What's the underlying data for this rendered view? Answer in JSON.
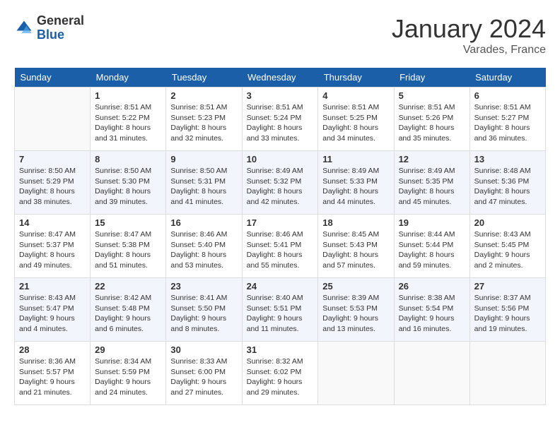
{
  "header": {
    "logo_general": "General",
    "logo_blue": "Blue",
    "month": "January 2024",
    "location": "Varades, France"
  },
  "weekdays": [
    "Sunday",
    "Monday",
    "Tuesday",
    "Wednesday",
    "Thursday",
    "Friday",
    "Saturday"
  ],
  "weeks": [
    [
      {
        "day": "",
        "content": ""
      },
      {
        "day": "1",
        "content": "Sunrise: 8:51 AM\nSunset: 5:22 PM\nDaylight: 8 hours\nand 31 minutes."
      },
      {
        "day": "2",
        "content": "Sunrise: 8:51 AM\nSunset: 5:23 PM\nDaylight: 8 hours\nand 32 minutes."
      },
      {
        "day": "3",
        "content": "Sunrise: 8:51 AM\nSunset: 5:24 PM\nDaylight: 8 hours\nand 33 minutes."
      },
      {
        "day": "4",
        "content": "Sunrise: 8:51 AM\nSunset: 5:25 PM\nDaylight: 8 hours\nand 34 minutes."
      },
      {
        "day": "5",
        "content": "Sunrise: 8:51 AM\nSunset: 5:26 PM\nDaylight: 8 hours\nand 35 minutes."
      },
      {
        "day": "6",
        "content": "Sunrise: 8:51 AM\nSunset: 5:27 PM\nDaylight: 8 hours\nand 36 minutes."
      }
    ],
    [
      {
        "day": "7",
        "content": "Sunrise: 8:50 AM\nSunset: 5:29 PM\nDaylight: 8 hours\nand 38 minutes."
      },
      {
        "day": "8",
        "content": "Sunrise: 8:50 AM\nSunset: 5:30 PM\nDaylight: 8 hours\nand 39 minutes."
      },
      {
        "day": "9",
        "content": "Sunrise: 8:50 AM\nSunset: 5:31 PM\nDaylight: 8 hours\nand 41 minutes."
      },
      {
        "day": "10",
        "content": "Sunrise: 8:49 AM\nSunset: 5:32 PM\nDaylight: 8 hours\nand 42 minutes."
      },
      {
        "day": "11",
        "content": "Sunrise: 8:49 AM\nSunset: 5:33 PM\nDaylight: 8 hours\nand 44 minutes."
      },
      {
        "day": "12",
        "content": "Sunrise: 8:49 AM\nSunset: 5:35 PM\nDaylight: 8 hours\nand 45 minutes."
      },
      {
        "day": "13",
        "content": "Sunrise: 8:48 AM\nSunset: 5:36 PM\nDaylight: 8 hours\nand 47 minutes."
      }
    ],
    [
      {
        "day": "14",
        "content": "Sunrise: 8:47 AM\nSunset: 5:37 PM\nDaylight: 8 hours\nand 49 minutes."
      },
      {
        "day": "15",
        "content": "Sunrise: 8:47 AM\nSunset: 5:38 PM\nDaylight: 8 hours\nand 51 minutes."
      },
      {
        "day": "16",
        "content": "Sunrise: 8:46 AM\nSunset: 5:40 PM\nDaylight: 8 hours\nand 53 minutes."
      },
      {
        "day": "17",
        "content": "Sunrise: 8:46 AM\nSunset: 5:41 PM\nDaylight: 8 hours\nand 55 minutes."
      },
      {
        "day": "18",
        "content": "Sunrise: 8:45 AM\nSunset: 5:43 PM\nDaylight: 8 hours\nand 57 minutes."
      },
      {
        "day": "19",
        "content": "Sunrise: 8:44 AM\nSunset: 5:44 PM\nDaylight: 8 hours\nand 59 minutes."
      },
      {
        "day": "20",
        "content": "Sunrise: 8:43 AM\nSunset: 5:45 PM\nDaylight: 9 hours\nand 2 minutes."
      }
    ],
    [
      {
        "day": "21",
        "content": "Sunrise: 8:43 AM\nSunset: 5:47 PM\nDaylight: 9 hours\nand 4 minutes."
      },
      {
        "day": "22",
        "content": "Sunrise: 8:42 AM\nSunset: 5:48 PM\nDaylight: 9 hours\nand 6 minutes."
      },
      {
        "day": "23",
        "content": "Sunrise: 8:41 AM\nSunset: 5:50 PM\nDaylight: 9 hours\nand 8 minutes."
      },
      {
        "day": "24",
        "content": "Sunrise: 8:40 AM\nSunset: 5:51 PM\nDaylight: 9 hours\nand 11 minutes."
      },
      {
        "day": "25",
        "content": "Sunrise: 8:39 AM\nSunset: 5:53 PM\nDaylight: 9 hours\nand 13 minutes."
      },
      {
        "day": "26",
        "content": "Sunrise: 8:38 AM\nSunset: 5:54 PM\nDaylight: 9 hours\nand 16 minutes."
      },
      {
        "day": "27",
        "content": "Sunrise: 8:37 AM\nSunset: 5:56 PM\nDaylight: 9 hours\nand 19 minutes."
      }
    ],
    [
      {
        "day": "28",
        "content": "Sunrise: 8:36 AM\nSunset: 5:57 PM\nDaylight: 9 hours\nand 21 minutes."
      },
      {
        "day": "29",
        "content": "Sunrise: 8:34 AM\nSunset: 5:59 PM\nDaylight: 9 hours\nand 24 minutes."
      },
      {
        "day": "30",
        "content": "Sunrise: 8:33 AM\nSunset: 6:00 PM\nDaylight: 9 hours\nand 27 minutes."
      },
      {
        "day": "31",
        "content": "Sunrise: 8:32 AM\nSunset: 6:02 PM\nDaylight: 9 hours\nand 29 minutes."
      },
      {
        "day": "",
        "content": ""
      },
      {
        "day": "",
        "content": ""
      },
      {
        "day": "",
        "content": ""
      }
    ]
  ]
}
